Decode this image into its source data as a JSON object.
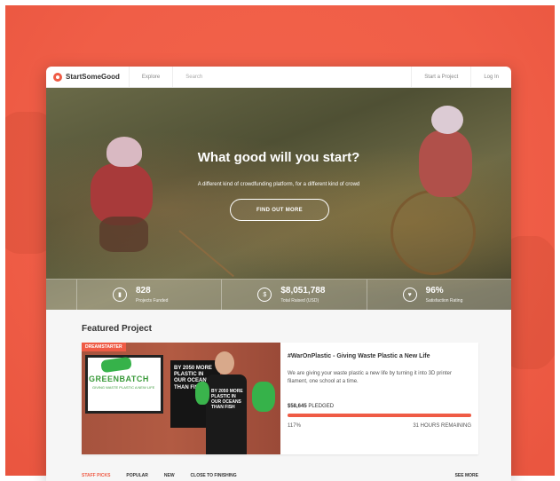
{
  "header": {
    "logo_text": "StartSomeGood",
    "nav_explore": "Explore",
    "search_placeholder": "Search",
    "start_project": "Start a Project",
    "login": "Log In"
  },
  "hero": {
    "title": "What good will you start?",
    "subtitle": "A different kind of crowdfunding platform, for a different kind of crowd",
    "cta": "FIND OUT MORE",
    "stats": [
      {
        "value": "828",
        "label": "Projects Funded",
        "icon": "bar-chart-icon"
      },
      {
        "value": "$8,051,788",
        "label": "Total Raised (USD)",
        "icon": "money-icon"
      },
      {
        "value": "96%",
        "label": "Satisfaction Rating",
        "icon": "heart-icon"
      }
    ]
  },
  "featured": {
    "section_title": "Featured Project",
    "badge": "DREAMSTARTER",
    "image_texts": {
      "screen": "GREENBATCH",
      "screen_sub": "GIVING WASTE PLASTIC A NEW LIFE",
      "sign": "BY 2050 MORE PLASTIC IN OUR OCEANS THAN FISH",
      "shirt": "BY 2050 MORE PLASTIC IN OUR OCEANS THAN FISH"
    },
    "project_title": "#WarOnPlastic - Giving Waste Plastic a New Life",
    "description": "We are giving your waste plastic a new life by turning it into 3D printer filament, one school at a time.",
    "pledged_amount": "$58,645",
    "pledged_label": "PLEDGED",
    "progress_fraction": 1.0,
    "percent": "117%",
    "remaining": "31 HOURS REMAINING"
  },
  "tabs": {
    "items": [
      "STAFF PICKS",
      "POPULAR",
      "NEW",
      "CLOSE TO FINISHING"
    ],
    "see_more": "SEE MORE"
  },
  "colors": {
    "accent": "#ef5b45",
    "background": "#f05e47"
  }
}
